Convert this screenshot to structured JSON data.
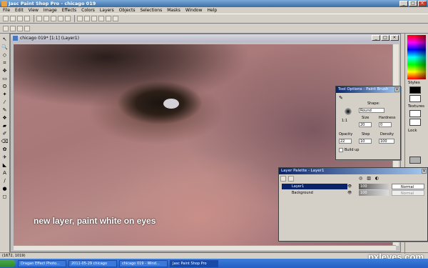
{
  "app": {
    "title": "Jasc Paint Shop Pro - chicago 019"
  },
  "menu": [
    "File",
    "Edit",
    "View",
    "Image",
    "Effects",
    "Colors",
    "Layers",
    "Objects",
    "Selections",
    "Masks",
    "Window",
    "Help"
  ],
  "document": {
    "title": "chicago 019* [1:1] (Layer1)"
  },
  "caption": "new layer, paint white on eyes",
  "right_panel": {
    "styles": "Styles",
    "textures": "Textures",
    "lock": "Lock"
  },
  "tool_options": {
    "title": "Tool Options - Paint Brush",
    "shape_label": "Shape:",
    "shape_value": "Round",
    "size_label": "Size",
    "size_value": "20",
    "hardness_label": "Hardness",
    "hardness_value": "0",
    "scale": "1:1",
    "opacity_label": "Opacity",
    "opacity_value": "22",
    "step_label": "Step",
    "step_value": "10",
    "density_label": "Density",
    "density_value": "100",
    "build_up_label": "Build up"
  },
  "layer_palette": {
    "title": "Layer Palette - Layer1",
    "layers": [
      {
        "name": "Layer1",
        "opacity": "100",
        "mode": "Normal",
        "selected": true
      },
      {
        "name": "Background",
        "opacity": "100",
        "mode": "Normal",
        "selected": false
      }
    ]
  },
  "status": {
    "coords": "(1672, 1019)"
  },
  "taskbar": {
    "items": [
      "Dragan Effect Photo...",
      "2011-05-29 chicago",
      "chicago 019 - Wind...",
      "Jasc Paint Shop Pro"
    ]
  },
  "watermark": "pxleyes.com",
  "colors": {
    "title_active": "#0a246a",
    "taskbar": "#245dc4"
  }
}
